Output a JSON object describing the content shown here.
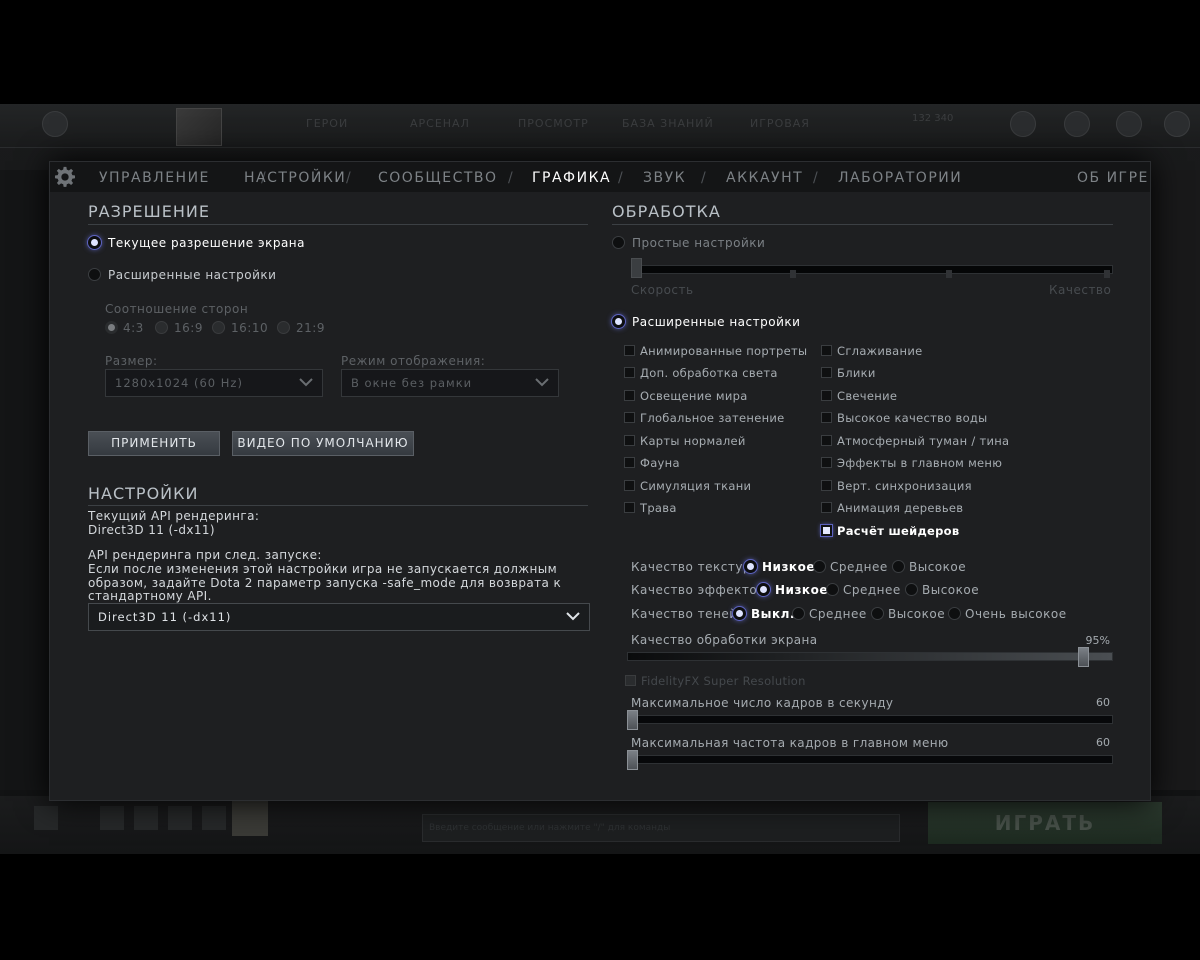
{
  "background": {
    "nav": [
      "ГЕРОИ",
      "АРСЕНАЛ",
      "ПРОСМОТР",
      "БАЗА ЗНАНИЙ",
      "ИГРОВАЯ"
    ],
    "coins": "132 340",
    "play_label": "ИГРАТЬ",
    "chat_placeholder": "Введите сообщение или нажмите \"/\" для команды"
  },
  "tabs": {
    "controls": "УПРАВЛЕНИЕ",
    "settings": "НАСТРОЙКИ",
    "community": "СООБЩЕСТВО",
    "graphics": "ГРАФИКА",
    "sound": "ЗВУК",
    "account": "АККАУНТ",
    "labs": "ЛАБОРАТОРИИ",
    "about": "ОБ ИГРЕ",
    "separator": "/"
  },
  "resolution": {
    "title": "РАЗРЕШЕНИЕ",
    "current_screen": "Текущее разрешение экрана",
    "advanced": "Расширенные настройки",
    "aspect_label": "Соотношение сторон",
    "aspects": [
      "4:3",
      "16:9",
      "16:10",
      "21:9"
    ],
    "size_label": "Размер:",
    "size_value": "1280x1024 (60 Hz)",
    "mode_label": "Режим отображения:",
    "mode_value": "В окне без рамки",
    "apply": "ПРИМЕНИТЬ",
    "video_default": "ВИДЕО ПО УМОЛЧАНИЮ"
  },
  "render": {
    "title": "НАСТРОЙКИ",
    "current_api_label": "Текущий API рендеринга:",
    "current_api_value": "Direct3D 11 (-dx11)",
    "next_api_label": "API рендеринга при след. запуске:",
    "warning_1": "Если после изменения этой настройки игра не запускается должным",
    "warning_2": "образом, задайте Dota 2 параметр запуска -safe_mode для возврата к",
    "warning_3": "стандартному API.",
    "api_select": "Direct3D 11 (-dx11)"
  },
  "processing": {
    "title": "ОБРАБОТКА",
    "simple": "Простые настройки",
    "speed": "Скорость",
    "quality": "Качество",
    "advanced": "Расширенные настройки",
    "checks_left": [
      "Анимированные портреты",
      "Доп. обработка света",
      "Освещение мира",
      "Глобальное затенение",
      "Карты нормалей",
      "Фауна",
      "Симуляция ткани",
      "Трава"
    ],
    "checks_right": [
      "Сглаживание",
      "Блики",
      "Свечение",
      "Высокое качество воды",
      "Атмосферный туман / тина",
      "Эффекты в главном меню",
      "Верт. синхронизация",
      "Анимация деревьев",
      "Расчёт шейдеров"
    ],
    "texture_label": "Качество текстур",
    "texture_opts": [
      "Низкое",
      "Среднее",
      "Высокое"
    ],
    "effects_label": "Качество эффектов",
    "effects_opts": [
      "Низкое",
      "Среднее",
      "Высокое"
    ],
    "shadow_label": "Качество теней",
    "shadow_opts": [
      "Выкл.",
      "Среднее",
      "Высокое",
      "Очень высокое"
    ],
    "screen_quality_label": "Качество обработки экрана",
    "screen_quality_value": "95%",
    "screen_quality_level": 0.95,
    "fsr_label": "FidelityFX Super Resolution",
    "fps_label": "Максимальное число кадров в секунду",
    "fps_value": "60",
    "menu_fps_label": "Максимальная частота кадров в главном меню",
    "menu_fps_value": "60"
  }
}
